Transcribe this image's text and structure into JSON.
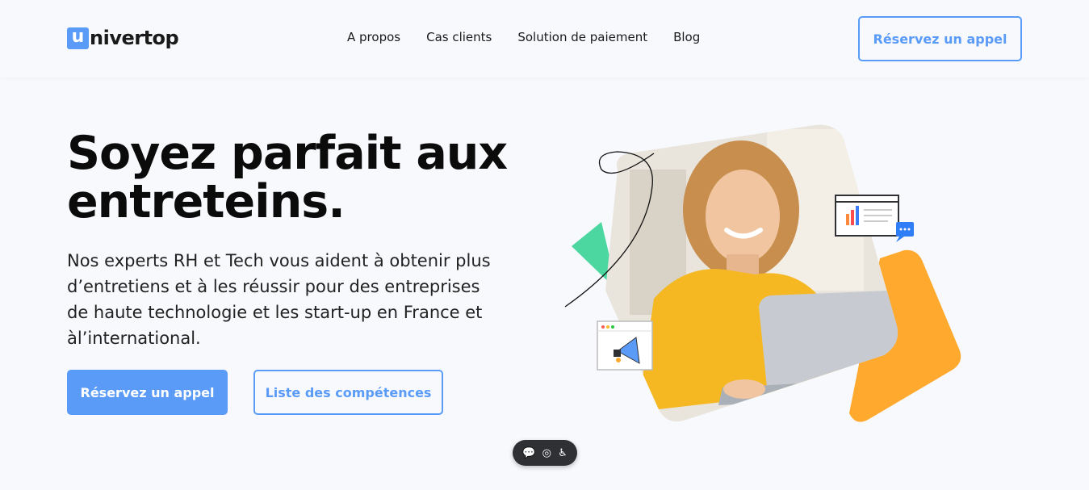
{
  "brand": {
    "logo_letter": "u",
    "logo_rest": "nivertop",
    "accent": "#5b9bf8"
  },
  "nav": {
    "items": [
      {
        "label": "A propos"
      },
      {
        "label": "Cas clients"
      },
      {
        "label": "Solution de paiement"
      },
      {
        "label": "Blog"
      }
    ]
  },
  "header": {
    "cta_label": "Réservez un appel"
  },
  "hero": {
    "title_line1": "Soyez parfait aux",
    "title_line2": "entreteins.",
    "description": "Nos experts RH et Tech vous aident à obtenir plus d’entretiens et à les réussir pour des entreprises de haute technologie et les start-up en France et àl’international.",
    "primary_cta": "Réservez un appel",
    "secondary_cta": "Liste des compétences"
  },
  "floating_toolbar": {
    "icons": [
      "chat-icon",
      "toggle-icon",
      "accessibility-icon"
    ],
    "glyphs": [
      "💬",
      "◎",
      "♿"
    ]
  }
}
